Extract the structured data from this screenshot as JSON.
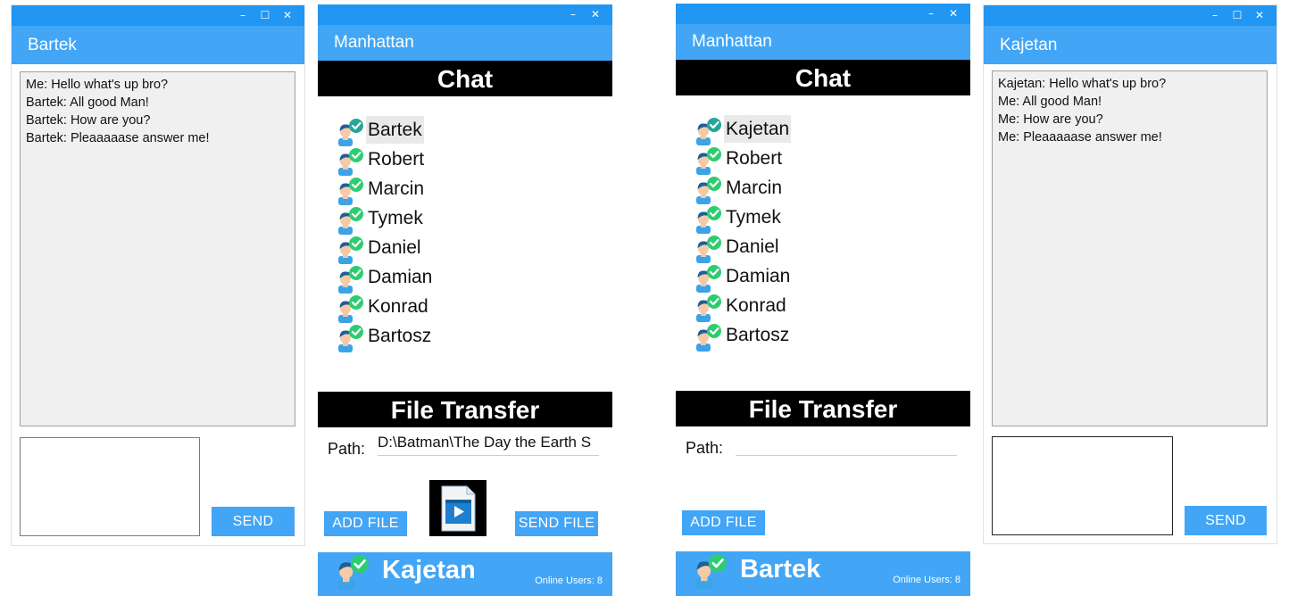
{
  "window_controls": {
    "minimize": "–",
    "maximize": "☐",
    "close": "✕"
  },
  "colors": {
    "titlebar": "#2196F3",
    "appbar": "#42A5F5",
    "status_online": "#2ECC71",
    "selected_status": "#26A69A"
  },
  "chat_window_bartek": {
    "title": "Bartek",
    "messages": [
      "Me: Hello what's up bro?",
      "Bartek: All good Man!",
      "Bartek: How are you?",
      "Bartek: Pleaaaaase answer me!"
    ],
    "compose_value": "",
    "send_label": "SEND"
  },
  "main_window_kajetan": {
    "title": "Manhattan",
    "chat_header": "Chat",
    "users": [
      "Bartek",
      "Robert",
      "Marcin",
      "Tymek",
      "Daniel",
      "Damian",
      "Konrad",
      "Bartosz"
    ],
    "selected_user": "Bartek",
    "file_transfer_header": "File Transfer",
    "path_label": "Path:",
    "path_value": "D:\\Batman\\The Day the Earth S",
    "add_file_label": "ADD FILE",
    "send_file_label": "SEND FILE",
    "file_icon": "video-file-icon",
    "current_user": "Kajetan",
    "online_users": "Online Users: 8"
  },
  "main_window_bartek": {
    "title": "Manhattan",
    "chat_header": "Chat",
    "users": [
      "Kajetan",
      "Robert",
      "Marcin",
      "Tymek",
      "Daniel",
      "Damian",
      "Konrad",
      "Bartosz"
    ],
    "selected_user": "Kajetan",
    "file_transfer_header": "File Transfer",
    "path_label": "Path:",
    "path_value": "",
    "add_file_label": "ADD FILE",
    "current_user": "Bartek",
    "online_users": "Online Users: 8"
  },
  "chat_window_kajetan": {
    "title": "Kajetan",
    "messages": [
      "Kajetan: Hello what's up bro?",
      "Me: All good Man!",
      "Me: How are you?",
      "Me: Pleaaaaase answer me!"
    ],
    "compose_value": "",
    "send_label": "SEND"
  }
}
